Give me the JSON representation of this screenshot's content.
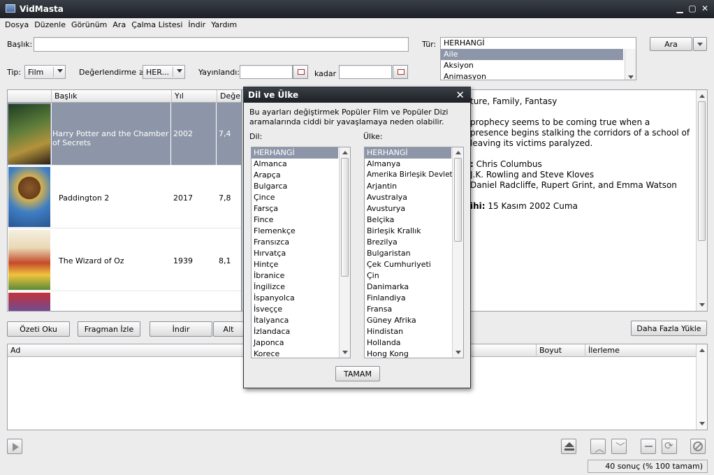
{
  "window": {
    "title": "VidMasta"
  },
  "menu": [
    "Dosya",
    "Düzenle",
    "Görünüm",
    "Ara",
    "Çalma Listesi",
    "İndir",
    "Yardım"
  ],
  "search": {
    "title_label": "Başlık:",
    "title_value": "",
    "genre_label": "Tür:",
    "genre_header": "HERHANGİ",
    "genres": [
      "Aile",
      "Aksiyon",
      "Animasyon"
    ],
    "search_button": "Ara",
    "type_label": "Tip:",
    "type_value": "Film",
    "rating_label": "Değerlendirme ≥:",
    "rating_value": "HER...",
    "released_label": "Yayınlandı:",
    "until_label": "kadar"
  },
  "results": {
    "columns": [
      "Başlık",
      "Yıl",
      "Değerle"
    ],
    "rows": [
      {
        "title": "Harry Potter and the Chamber of Secrets",
        "year": "2002",
        "rating": "7,4",
        "poster": "harry-potter-poster"
      },
      {
        "title": "Paddington 2",
        "year": "2017",
        "rating": "7,8",
        "poster": "paddington-poster"
      },
      {
        "title": "The Wizard of Oz",
        "year": "1939",
        "rating": "8,1",
        "poster": "wizard-of-oz-poster"
      }
    ]
  },
  "details": {
    "lines": [
      {
        "label": "",
        "text": "ture, Family, Fantasy"
      },
      {
        "label": "",
        "text": "prophecy seems to be coming true when a"
      },
      {
        "label": "",
        "text": "presence begins stalking the corridors of a school of"
      },
      {
        "label": "",
        "text": "leaving its victims paralyzed."
      },
      {
        "label": ":",
        "text": " Chris Columbus"
      },
      {
        "label": "",
        "text": "J.K. Rowling and Steve Kloves"
      },
      {
        "label": "",
        "text": "Daniel Radcliffe, Rupert Grint, and Emma Watson"
      },
      {
        "label": "ihi:",
        "text": " 15 Kasım 2002 Cuma"
      }
    ]
  },
  "actions": {
    "summary": "Özeti Oku",
    "trailer": "Fragman İzle",
    "download": "İndir",
    "subtitle": "Alt",
    "load_more": "Daha Fazla Yükle"
  },
  "downloads": {
    "columns": [
      "Ad",
      "Boyut",
      "İlerleme"
    ]
  },
  "status": "40 sonuç (% 100 tamam)",
  "dialog": {
    "title": "Dil ve Ülke",
    "warning": "Bu ayarları değiştirmek Popüler Film ve Popüler Dizi aramalarında ciddi bir yavaşlamaya neden olabilir.",
    "language_label": "Dil:",
    "country_label": "Ülke:",
    "languages": [
      "HERHANGİ",
      "Almanca",
      "Arapça",
      "Bulgarca",
      "Çince",
      "Farsça",
      "Fince",
      "Flemenkçe",
      "Fransızca",
      "Hırvatça",
      "Hintçe",
      "İbranice",
      "İngilizce",
      "İspanyolca",
      "İsveççe",
      "İtalyanca",
      "İzlandaca",
      "Japonca",
      "Korece"
    ],
    "countries": [
      "HERHANGİ",
      "Almanya",
      "Amerika Birleşik Devletleri",
      "Arjantin",
      "Avustralya",
      "Avusturya",
      "Belçika",
      "Birleşik Krallık",
      "Brezilya",
      "Bulgaristan",
      "Çek Cumhuriyeti",
      "Çin",
      "Danimarka",
      "Finlandiya",
      "Fransa",
      "Güney Afrika",
      "Hindistan",
      "Hollanda",
      "Hong Kong"
    ],
    "ok_button": "TAMAM"
  },
  "colors": {
    "selection": "#8d96a8",
    "titlebar": "#23272d"
  }
}
